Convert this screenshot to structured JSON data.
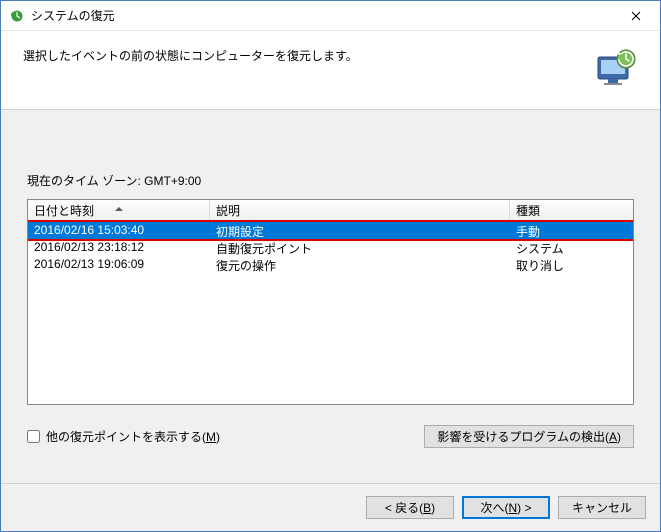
{
  "window": {
    "title": "システムの復元"
  },
  "header": {
    "text": "選択したイベントの前の状態にコンピューターを復元します。"
  },
  "timezone": {
    "label": "現在のタイム ゾーン: GMT+9:00"
  },
  "table": {
    "columns": {
      "datetime": "日付と時刻",
      "description": "説明",
      "type": "種類"
    },
    "rows": [
      {
        "datetime": "2016/02/16 15:03:40",
        "description": "初期設定",
        "type": "手動",
        "selected": true
      },
      {
        "datetime": "2016/02/13 23:18:12",
        "description": "自動復元ポイント",
        "type": "システム",
        "selected": false
      },
      {
        "datetime": "2016/02/13 19:06:09",
        "description": "復元の操作",
        "type": "取り消し",
        "selected": false
      }
    ]
  },
  "showMore": {
    "label": "他の復元ポイントを表示する(",
    "mnemonic": "M",
    "suffix": ")"
  },
  "scanBtn": {
    "label": "影響を受けるプログラムの検出(",
    "mnemonic": "A",
    "suffix": ")"
  },
  "footer": {
    "back": "< 戻る(",
    "back_m": "B",
    "next": "次へ(",
    "next_m": "N",
    "next_suffix": ") >",
    "cancel": "キャンセル",
    "close_suffix": ")"
  }
}
